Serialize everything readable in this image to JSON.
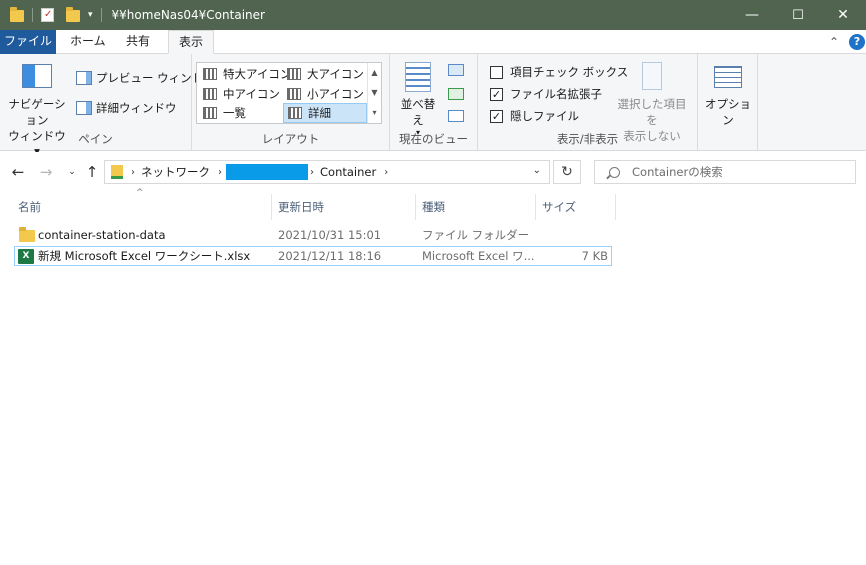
{
  "window": {
    "title": "¥¥homeNas04¥Container",
    "minimize": "—",
    "maximize": "☐",
    "close": "✕"
  },
  "tabs": [
    {
      "label": "ファイル"
    },
    {
      "label": "ホーム"
    },
    {
      "label": "共有"
    },
    {
      "label": "表示"
    }
  ],
  "ribbon": {
    "pane": {
      "label": "ペイン",
      "nav_pane_line1": "ナビゲーション",
      "nav_pane_line2": "ウィンドウ ▾",
      "preview": "プレビュー ウィンドウ",
      "details": "詳細ウィンドウ"
    },
    "layout": {
      "label": "レイアウト",
      "items": [
        "特大アイコン",
        "大アイコン",
        "中アイコン",
        "小アイコン",
        "一覧",
        "詳細"
      ]
    },
    "current_view": {
      "label": "現在のビュー",
      "sort": "並べ替え"
    },
    "show_hide": {
      "label": "表示/非表示",
      "item_checkbox": "項目チェック ボックス",
      "extensions": "ファイル名拡張子",
      "hidden": "隠しファイル",
      "hide_selected_line1": "選択した項目を",
      "hide_selected_line2": "表示しない"
    },
    "options": {
      "label": "オプション"
    }
  },
  "navigation": {
    "breadcrumb": [
      "ネットワーク",
      "Container"
    ],
    "search_placeholder": "Containerの検索"
  },
  "columns": [
    "名前",
    "更新日時",
    "種類",
    "サイズ"
  ],
  "files": [
    {
      "name": "container-station-data",
      "modified": "2021/10/31 15:01",
      "type": "ファイル フォルダー",
      "size": ""
    },
    {
      "name": "新規 Microsoft Excel ワークシート.xlsx",
      "modified": "2021/12/11 18:16",
      "type": "Microsoft Excel ワ...",
      "size": "7 KB"
    }
  ],
  "colors": {
    "titlebar": "#506450",
    "file_tab": "#1f5b9c",
    "selection": "#cce4f7",
    "redaction": "#0a9be8"
  }
}
